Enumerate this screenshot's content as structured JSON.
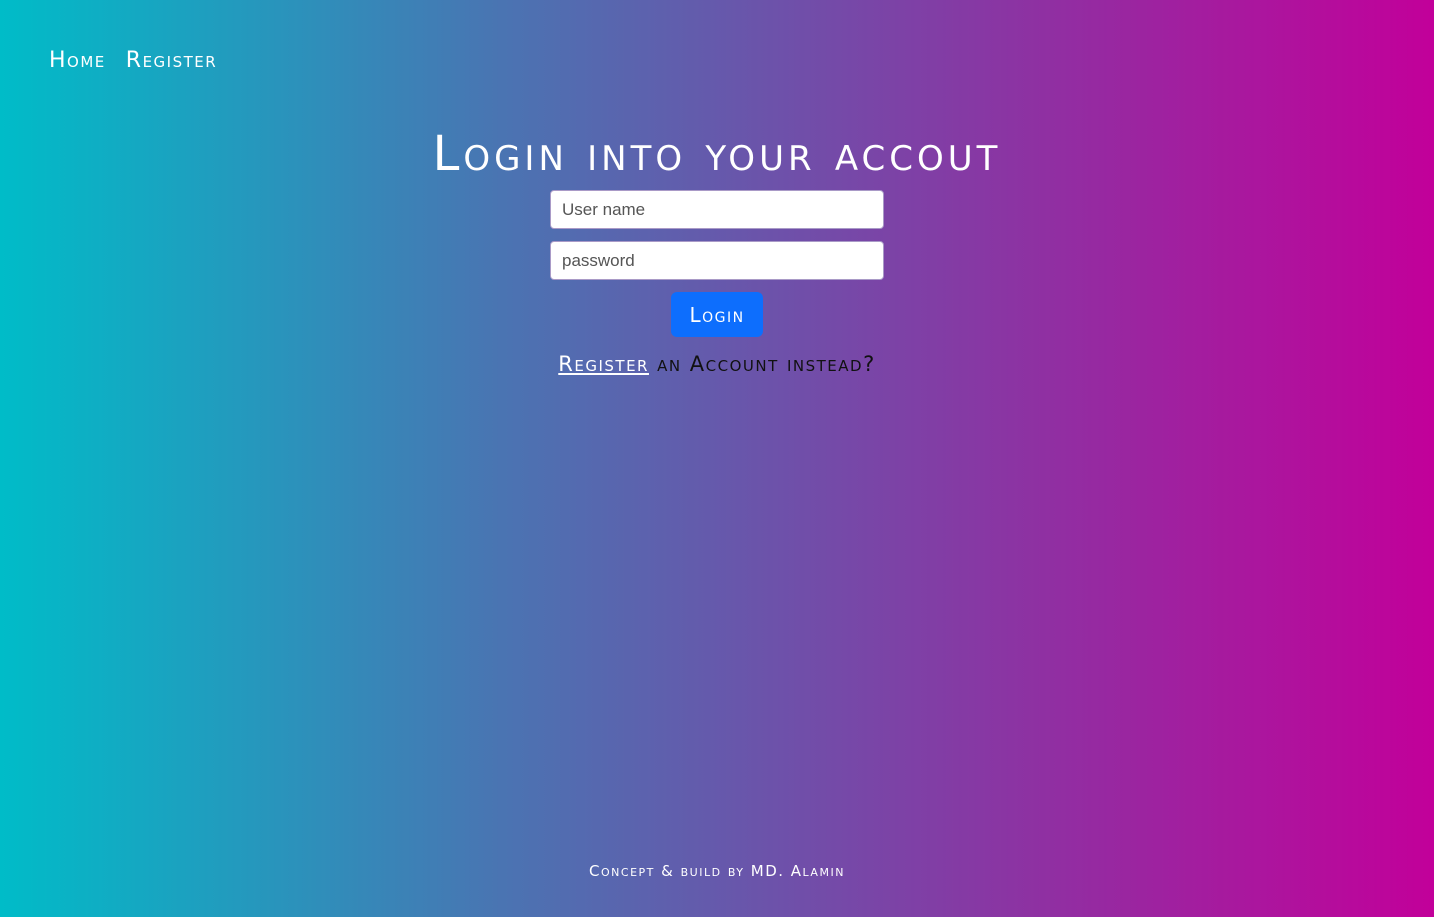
{
  "nav": {
    "home": "Home",
    "register": "Register"
  },
  "login": {
    "title": "Login into your accout",
    "username_placeholder": "User name",
    "password_placeholder": "password",
    "button": "Login",
    "register_link": "Register",
    "register_suffix": " an Account instead?"
  },
  "footer": {
    "credit": "Concept & build by MD. Alamin"
  },
  "colors": {
    "gradient_start": "#00bcc8",
    "gradient_end": "#c2009a",
    "button": "#0d6efd"
  }
}
